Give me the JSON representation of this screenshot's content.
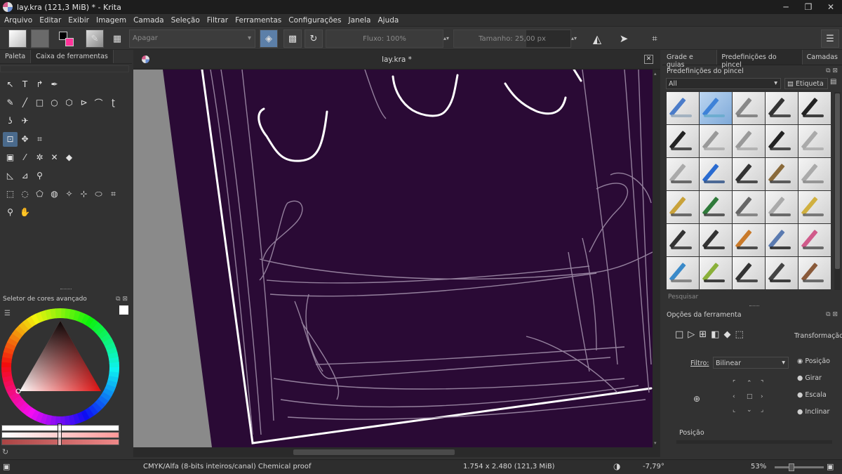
{
  "window": {
    "title": "lay.kra (121,3 MiB)  * - Krita",
    "controls": [
      "─",
      "❐",
      "✕"
    ]
  },
  "menu": [
    "Arquivo",
    "Editar",
    "Exibir",
    "Imagem",
    "Camada",
    "Seleção",
    "Filtrar",
    "Ferramentas",
    "Configurações",
    "Janela",
    "Ajuda"
  ],
  "toolbar": {
    "blend_mode": "Apagar",
    "flow_label": "Fluxo: 100%",
    "flow_value": 1.0,
    "size_label": "Tamanho: 25,00 px",
    "size_fill": 0.62
  },
  "left_dock": {
    "tabs": [
      "Paleta",
      "Caixa de ferramentas"
    ],
    "color_selector_title": "Seletor de cores avançado"
  },
  "document": {
    "tab_title": "lay.kra *"
  },
  "right_dock": {
    "tabs": [
      "Grade e guias",
      "Predefinições do pincel",
      "Camadas"
    ],
    "presets_title": "Predefinições do pincel",
    "filter_value": "All",
    "tag_label": "Etiqueta",
    "search_placeholder": "Pesquisar",
    "tool_options_title": "Opções da ferramenta",
    "transform_label": "Transformação",
    "filter_label": "Filtro:",
    "filter_select": "Bilinear",
    "modes": [
      "Posição",
      "Girar",
      "Escala",
      "Inclinar"
    ],
    "position_label": "Posição"
  },
  "status": {
    "color_space": "CMYK/Alfa (8-bits inteiros/canal)  Chemical proof",
    "image_size": "1.754 x 2.480 (121,3 MiB)",
    "rotation": "-7,79°",
    "zoom": "53%"
  },
  "colors": {
    "canvas_bg": "#2a0a35",
    "sketch": "#9a87a3",
    "ink": "#ffffff",
    "accent": "#4a6a8c"
  }
}
